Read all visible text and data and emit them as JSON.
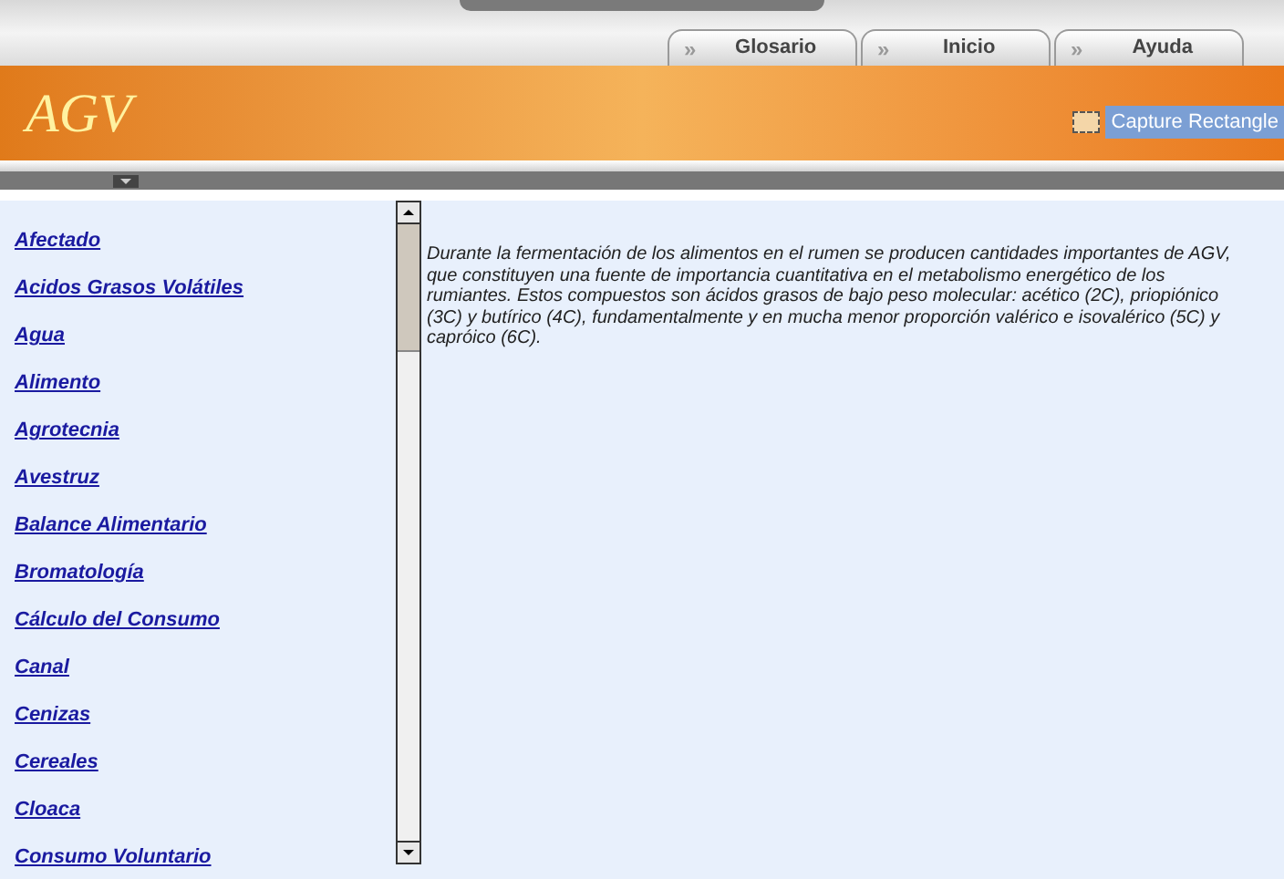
{
  "tabs": [
    {
      "label": "Glosario",
      "marker": "»"
    },
    {
      "label": "Inicio",
      "marker": "»"
    },
    {
      "label": "Ayuda",
      "marker": "»"
    }
  ],
  "banner": {
    "logo": "AGV",
    "capture_button": "Capture Rectangle"
  },
  "glossary": [
    {
      "term": "Afectado"
    },
    {
      "term": "Acidos Grasos Volátiles"
    },
    {
      "term": "Agua"
    },
    {
      "term": "Alimento"
    },
    {
      "term": "Agrotecnia"
    },
    {
      "term": "Avestruz"
    },
    {
      "term": "Balance Alimentario"
    },
    {
      "term": "Bromatología"
    },
    {
      "term": "Cálculo del Consumo"
    },
    {
      "term": "Canal"
    },
    {
      "term": "Cenizas"
    },
    {
      "term": "Cereales"
    },
    {
      "term": "Cloaca"
    },
    {
      "term": "Consumo Voluntario"
    }
  ],
  "definition": "Durante la fermentación de los alimentos en el rumen se producen cantidades importantes de AGV, que constituyen una fuente de importancia cuantitativa en el metabolismo energético de los rumiantes. Estos compuestos son ácidos grasos de bajo peso molecular: acético (2C), priopiónico (3C) y butírico (4C), fundamentalmente y en mucha menor proporción valérico e isovalérico (5C) y capróico (6C)."
}
